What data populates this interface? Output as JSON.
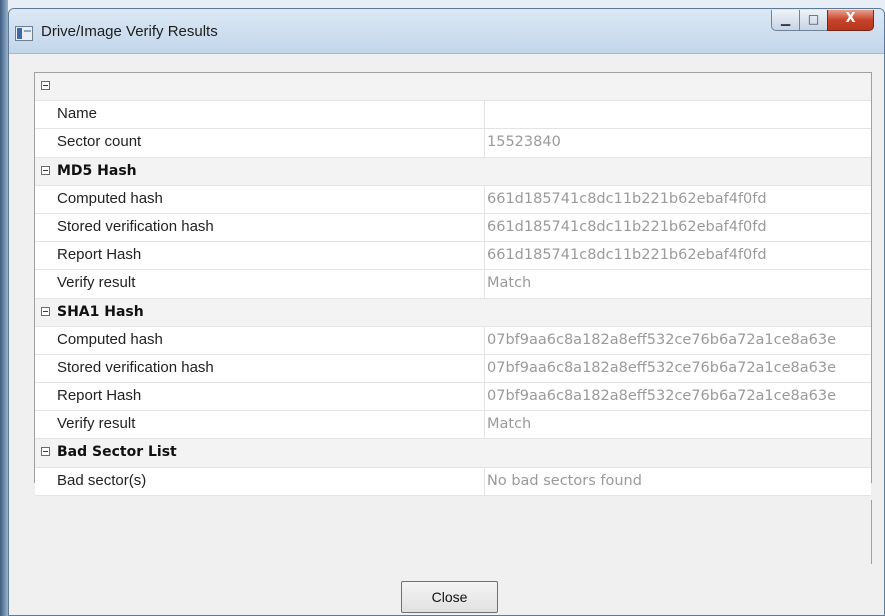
{
  "window": {
    "title": "Drive/Image Verify Results",
    "close_button_label": "Close",
    "caption_min_glyph": "▁",
    "caption_max_glyph": "□",
    "caption_close_glyph": "X",
    "icons": [
      "window-app-icon",
      "minimize-icon",
      "maximize-icon",
      "close-icon",
      "collapse-icon"
    ]
  },
  "property_grid": {
    "rows": [
      {
        "type": "category",
        "label": ""
      },
      {
        "type": "property",
        "name": "Name",
        "value": ""
      },
      {
        "type": "property",
        "name": "Sector count",
        "value": "15523840"
      },
      {
        "type": "category",
        "label": "MD5 Hash"
      },
      {
        "type": "property",
        "name": "Computed hash",
        "value": "661d185741c8dc11b221b62ebaf4f0fd"
      },
      {
        "type": "property",
        "name": "Stored verification hash",
        "value": "661d185741c8dc11b221b62ebaf4f0fd"
      },
      {
        "type": "property",
        "name": "Report Hash",
        "value": "661d185741c8dc11b221b62ebaf4f0fd"
      },
      {
        "type": "property",
        "name": "Verify result",
        "value": "Match"
      },
      {
        "type": "category",
        "label": "SHA1 Hash"
      },
      {
        "type": "property",
        "name": "Computed hash",
        "value": "07bf9aa6c8a182a8eff532ce76b6a72a1ce8a63e"
      },
      {
        "type": "property",
        "name": "Stored verification hash",
        "value": "07bf9aa6c8a182a8eff532ce76b6a72a1ce8a63e"
      },
      {
        "type": "property",
        "name": "Report Hash",
        "value": "07bf9aa6c8a182a8eff532ce76b6a72a1ce8a63e"
      },
      {
        "type": "property",
        "name": "Verify result",
        "value": "Match"
      },
      {
        "type": "category",
        "label": "Bad Sector List"
      },
      {
        "type": "property",
        "name": "Bad sector(s)",
        "value": "No bad sectors found"
      }
    ]
  },
  "colors": {
    "value_text": "#9a9a9a",
    "category_background": "#f3f3f3",
    "title_bar": "#c3d6ea",
    "close_caption": "#c6432a"
  }
}
